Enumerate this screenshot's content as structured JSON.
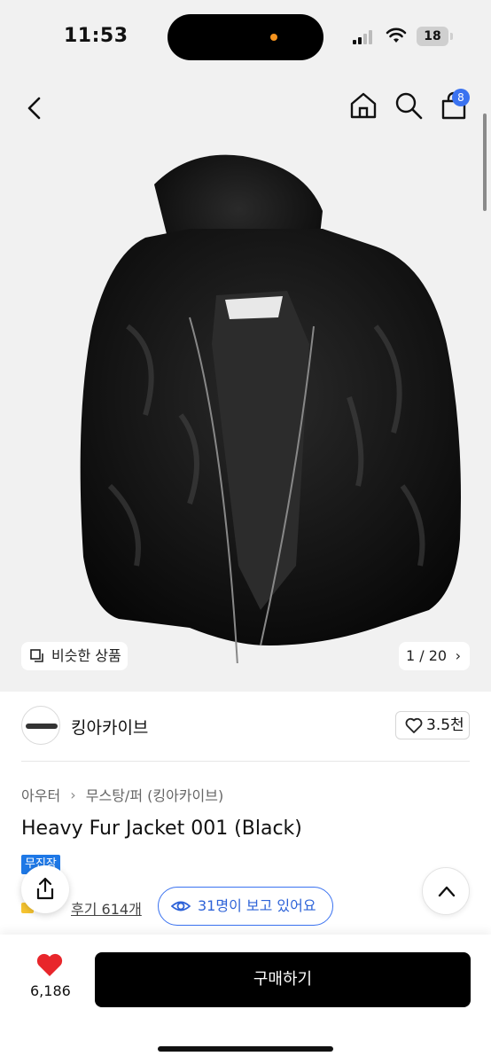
{
  "status_bar": {
    "time": "11:53",
    "battery": "18"
  },
  "nav": {
    "cart_count": "8"
  },
  "gallery": {
    "similar_label": "비슷한 상품",
    "counter": "1 / 20",
    "counter_chevron": "›"
  },
  "brand": {
    "name": "킹아카이브",
    "likes": "3.5천"
  },
  "breadcrumb": {
    "category": "아우터",
    "separator": "›",
    "subcategory": "무스탕/퍼 (킹아카이브)"
  },
  "product": {
    "title": "Heavy Fur Jacket 001 (Black)",
    "tag": "무진장",
    "reviews": "후기 614개",
    "viewers": "31명이 보고 있어요"
  },
  "bottom": {
    "favorite_count": "6,186",
    "buy_label": "구매하기"
  },
  "colors": {
    "accent_blue": "#3a72f0",
    "heart_red": "#e8262b",
    "tag_blue": "#1e78e6"
  },
  "icons": [
    "back-icon",
    "home-icon",
    "search-icon",
    "cart-icon",
    "similar-icon",
    "heart-outline-icon",
    "share-icon",
    "eye-icon",
    "chevron-up-icon",
    "heart-filled-icon"
  ]
}
